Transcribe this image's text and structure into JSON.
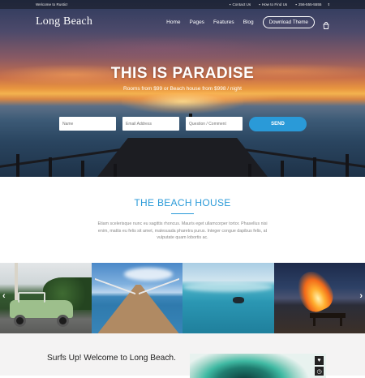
{
  "topbar": {
    "welcome": "Welcome to Rustic!",
    "contact": "Contact Us",
    "find": "How to Find Us",
    "phone": "256-555-5555",
    "twitter_icon": "twitter-icon"
  },
  "nav": {
    "logo": "Long Beach",
    "items": [
      "Home",
      "Pages",
      "Features",
      "Blog"
    ],
    "download": "Download Theme",
    "cart_icon": "shopping-bag-icon"
  },
  "hero": {
    "title": "THIS IS PARADISE",
    "subtitle": "Rooms from $99 or Beach house from $998 / night",
    "form": {
      "name_placeholder": "Name",
      "email_placeholder": "Email Address",
      "question_placeholder": "Question / Comment",
      "send_label": "SEND"
    }
  },
  "about": {
    "title": "THE BEACH HOUSE",
    "text": "Etiam scelerisque nunc eu sagittis rhoncus. Mauris eget ullamcorper tortor. Phasellus nisi enim, mattis eu felis sit amet, malesuada pharetra purus. Integer congue dapibus felis, at vulputate quam lobortis ac."
  },
  "gallery": {
    "prev": "‹",
    "next": "›"
  },
  "bottom": {
    "heading": "Surfs Up! Welcome to Long Beach.",
    "icons": [
      "heart-icon",
      "clock-icon"
    ]
  },
  "colors": {
    "accent": "#2a9ad8",
    "heading": "#222222",
    "bottom_bg": "#f4f3f3"
  }
}
